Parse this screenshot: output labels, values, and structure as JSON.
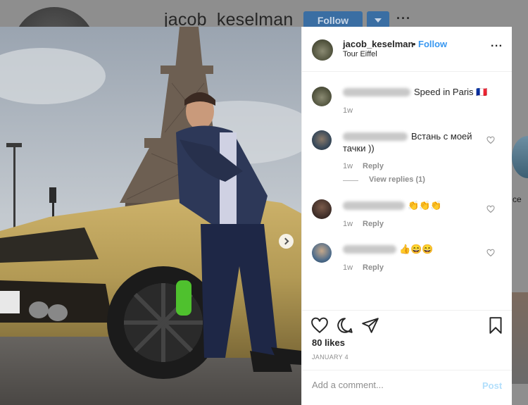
{
  "background_profile": {
    "username": "jacob_keselman",
    "follow_label": "Follow",
    "more_icon": "···",
    "side_text": "ce"
  },
  "post": {
    "username": "jacob_keselman",
    "separator": "•",
    "follow_label": "Follow",
    "location": "Tour Eiffel",
    "more_icon": "···"
  },
  "comments": [
    {
      "text": "Speed in Paris 🇫🇷",
      "time": "1w",
      "reply_label": "",
      "has_like": false
    },
    {
      "text_line1": "Встань с моей",
      "text_line2": "тачки ))",
      "time": "1w",
      "reply_label": "Reply",
      "has_like": true,
      "view_replies": "View replies (1)"
    },
    {
      "text": "👏👏👏",
      "time": "1w",
      "reply_label": "Reply",
      "has_like": true
    },
    {
      "text": "👍😄😄",
      "time": "1w",
      "reply_label": "Reply",
      "has_like": true
    }
  ],
  "actions": {
    "like_icon": "heart-icon",
    "comment_icon": "comment-bubble-icon",
    "share_icon": "paper-plane-icon",
    "save_icon": "bookmark-icon"
  },
  "likes": "80 likes",
  "date": "JANUARY 4",
  "add_comment": {
    "placeholder": "Add a comment...",
    "post_label": "Post"
  },
  "colors": {
    "link_blue": "#3897f0",
    "post_disabled": "#b2dffc",
    "car_gold": "#b39a55"
  }
}
